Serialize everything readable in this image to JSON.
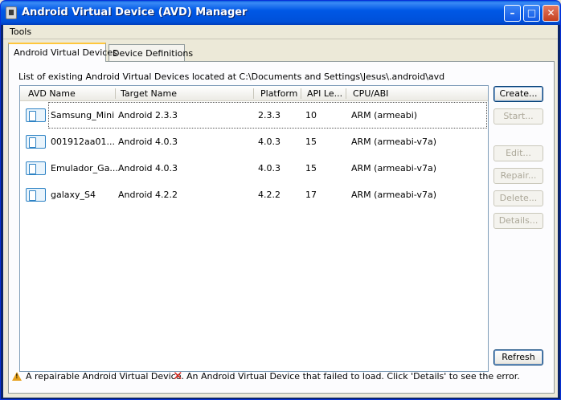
{
  "window": {
    "title": "Android Virtual Device (AVD) Manager",
    "minimize_glyph": "–",
    "maximize_glyph": "□",
    "close_glyph": "✕"
  },
  "menu": {
    "items": [
      "Tools"
    ]
  },
  "tabs": [
    {
      "label": "Android Virtual Devices",
      "active": true
    },
    {
      "label": "Device Definitions",
      "active": false
    }
  ],
  "location_text": "List of existing Android Virtual Devices located at C:\\Documents and Settings\\Jesus\\.android\\avd",
  "table": {
    "columns": [
      "AVD Name",
      "Target Name",
      "Platform",
      "API Le...",
      "CPU/ABI"
    ],
    "rows": [
      {
        "name": "Samsung_Mini",
        "target": "Android 2.3.3",
        "platform": "2.3.3",
        "api": "10",
        "cpu": "ARM (armeabi)"
      },
      {
        "name": "001912aa01...",
        "target": "Android 4.0.3",
        "platform": "4.0.3",
        "api": "15",
        "cpu": "ARM (armeabi-v7a)"
      },
      {
        "name": "Emulador_Ga...",
        "target": "Android 4.0.3",
        "platform": "4.0.3",
        "api": "15",
        "cpu": "ARM (armeabi-v7a)"
      },
      {
        "name": "galaxy_S4",
        "target": "Android 4.2.2",
        "platform": "4.2.2",
        "api": "17",
        "cpu": "ARM (armeabi-v7a)"
      }
    ]
  },
  "buttons": {
    "create": "Create...",
    "start": "Start...",
    "edit": "Edit...",
    "repair": "Repair...",
    "delete": "Delete...",
    "details": "Details...",
    "refresh": "Refresh"
  },
  "legend": {
    "repairable": "A repairable Android Virtual Device.",
    "failed": "An Android Virtual Device that failed to load. Click 'Details' to see the error."
  },
  "colors": {
    "titlebar": "#0058e6",
    "tab_accent": "#ffc73c",
    "avd_icon": "#2d82c4",
    "warning": "#e6a11e",
    "error": "#d9251c"
  },
  "icons": [
    "app-icon",
    "avd-device-icon",
    "warning-icon",
    "error-icon"
  ]
}
